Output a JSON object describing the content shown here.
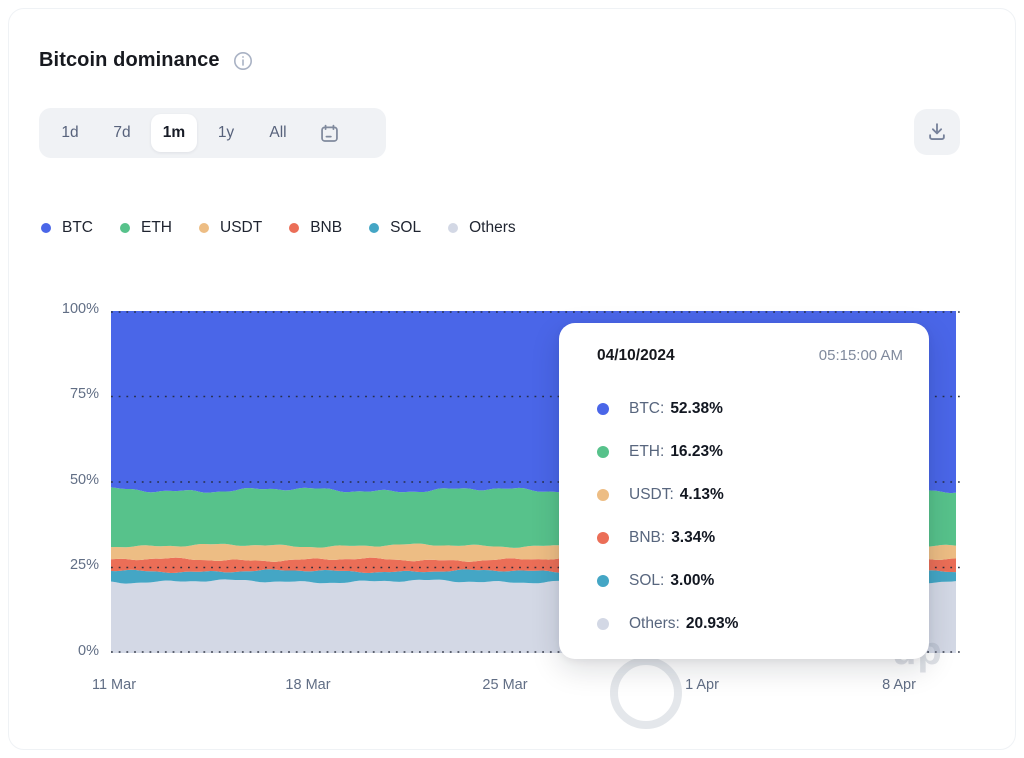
{
  "header": {
    "title": "Bitcoin dominance"
  },
  "controls": {
    "ranges": [
      {
        "label": "1d",
        "selected": false
      },
      {
        "label": "7d",
        "selected": false
      },
      {
        "label": "1m",
        "selected": true
      },
      {
        "label": "1y",
        "selected": false
      },
      {
        "label": "All",
        "selected": false
      }
    ]
  },
  "chart_data": {
    "type": "area",
    "stacked": true,
    "title": "Bitcoin dominance",
    "x_ticks": [
      "11 Mar",
      "18 Mar",
      "25 Mar",
      "1 Apr",
      "8 Apr"
    ],
    "y_ticks": [
      "100%",
      "75%",
      "50%",
      "25%",
      "0%"
    ],
    "y_tick_values": [
      100,
      75,
      50,
      25,
      0
    ],
    "ylim": [
      0,
      100
    ],
    "grid": "dotted-horizontal",
    "legend_position": "top",
    "series": [
      {
        "name": "BTC",
        "color": "#4A66E8",
        "percent": 52.38
      },
      {
        "name": "ETH",
        "color": "#57C28B",
        "percent": 16.23
      },
      {
        "name": "USDT",
        "color": "#EDBD84",
        "percent": 4.13
      },
      {
        "name": "BNB",
        "color": "#EB6E57",
        "percent": 3.34
      },
      {
        "name": "SOL",
        "color": "#44A6C5",
        "percent": 3.0
      },
      {
        "name": "Others",
        "color": "#D3D8E5",
        "percent": 20.93
      }
    ],
    "stack_order_bottom_to_top": [
      "Others",
      "SOL",
      "BNB",
      "USDT",
      "ETH",
      "BTC"
    ]
  },
  "tooltip": {
    "date": "04/10/2024",
    "time": "05:15:00 AM",
    "rows": [
      {
        "label": "BTC:",
        "value": "52.38%",
        "color": "#4A66E8"
      },
      {
        "label": "ETH:",
        "value": "16.23%",
        "color": "#57C28B"
      },
      {
        "label": "USDT:",
        "value": "4.13%",
        "color": "#EDBD84"
      },
      {
        "label": "BNB:",
        "value": "3.34%",
        "color": "#EB6E57"
      },
      {
        "label": "SOL:",
        "value": "3.00%",
        "color": "#44A6C5"
      },
      {
        "label": "Others:",
        "value": "20.93%",
        "color": "#D3D8E5"
      }
    ]
  },
  "watermark": {
    "text": "up"
  }
}
